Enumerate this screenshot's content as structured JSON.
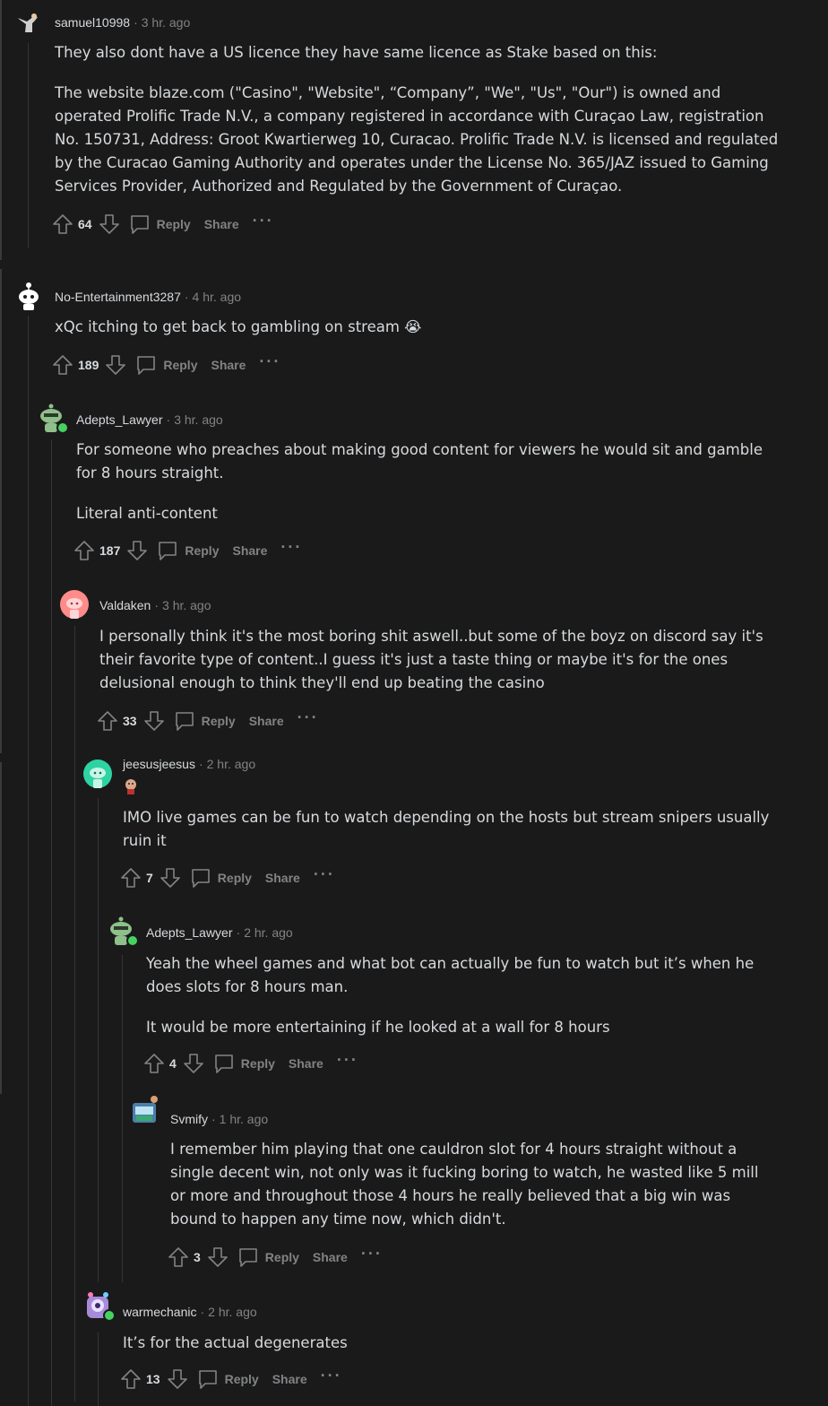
{
  "comments": [
    {
      "username": "samuel10998",
      "time": "3 hr. ago",
      "paragraphs": [
        "They also dont have a US licence they have same licence as Stake based on this:",
        "The website blaze.com (\"Casino\", \"Website\", “Company”, \"We\", \"Us\", \"Our\") is owned and operated Prolific Trade N.V., a company registered in accordance with Curaçao Law, registration No. 150731, Address: Groot Kwartierweg 10, Curacao. Prolific Trade N.V. is licensed and regulated by the Curacao Gaming Authority and operates under the License No. 365/JAZ issued to Gaming Services Provider, Authorized and Regulated by the Government of Curaçao."
      ],
      "votes": "64"
    },
    {
      "username": "No-Entertainment3287",
      "time": "4 hr. ago",
      "paragraphs": [
        "xQc itching to get back to gambling on stream 😭"
      ],
      "votes": "189"
    },
    {
      "username": "Adepts_Lawyer",
      "time": "3 hr. ago",
      "paragraphs": [
        "For someone who preaches about making good content for viewers he would sit and gamble for 8 hours straight.",
        "Literal anti-content"
      ],
      "votes": "187"
    },
    {
      "username": "Valdaken",
      "time": "3 hr. ago",
      "paragraphs": [
        "I personally think it's the most boring shit aswell..but some of the boyz on discord say it's their favorite type of content..I guess it's just a taste thing or maybe it's for the ones delusional enough to think they'll end up beating the casino"
      ],
      "votes": "33"
    },
    {
      "username": "jeesusjeesus",
      "time": "2 hr. ago",
      "paragraphs": [
        "IMO live games can be fun to watch depending on the hosts but stream snipers usually ruin it"
      ],
      "votes": "7"
    },
    {
      "username": "Adepts_Lawyer",
      "time": "2 hr. ago",
      "paragraphs": [
        "Yeah the wheel games and what bot can actually be fun to watch but it’s when he does slots for 8 hours man.",
        "It would be more entertaining if he looked at a wall for 8 hours"
      ],
      "votes": "4"
    },
    {
      "username": "Svmify",
      "time": "1 hr. ago",
      "paragraphs": [
        "I remember him playing that one cauldron slot for 4 hours straight without a single decent win, not only was it fucking boring to watch, he wasted like 5 mill or more and throughout those 4 hours he really believed that a big win was bound to happen any time now, which didn't."
      ],
      "votes": "3"
    },
    {
      "username": "warmechanic",
      "time": "2 hr. ago",
      "paragraphs": [
        "It’s for the actual degenerates"
      ],
      "votes": "13"
    }
  ],
  "labels": {
    "reply": "Reply",
    "share": "Share",
    "more": "···",
    "separator": "·"
  },
  "colors": {
    "background": "#1a1a1b",
    "text": "#d7dadc",
    "muted": "#818384",
    "online": "#46d160"
  }
}
